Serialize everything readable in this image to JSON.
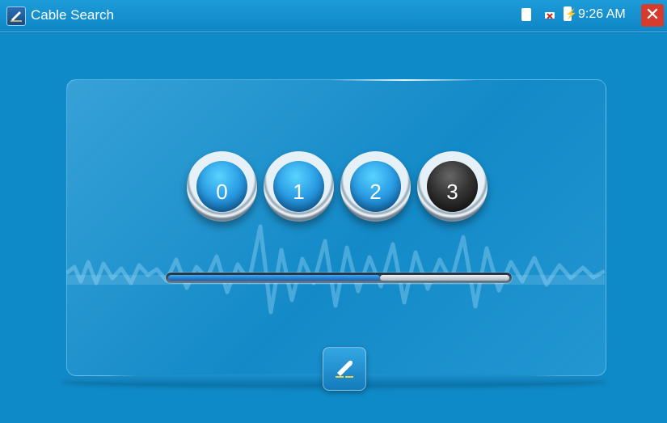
{
  "app": {
    "title": "Cable Search",
    "time": "9:26 AM",
    "close_symbol": "✕"
  },
  "status_icons": [
    "sd-card-icon",
    "network-disconnected-icon",
    "battery-charging-icon"
  ],
  "digit_buttons": [
    {
      "label": "0",
      "state": "normal"
    },
    {
      "label": "1",
      "state": "normal"
    },
    {
      "label": "2",
      "state": "normal"
    },
    {
      "label": "3",
      "state": "active"
    }
  ],
  "signal_progress": 0.62,
  "colors": {
    "background": "#0f8ac8",
    "active_digit": "#2b2b2b",
    "digit_blue": "#2c9fe6",
    "close_button": "#d73b2d"
  },
  "icons": {
    "app": "cable-search-icon",
    "bottom_button": "cable-probe-icon"
  }
}
